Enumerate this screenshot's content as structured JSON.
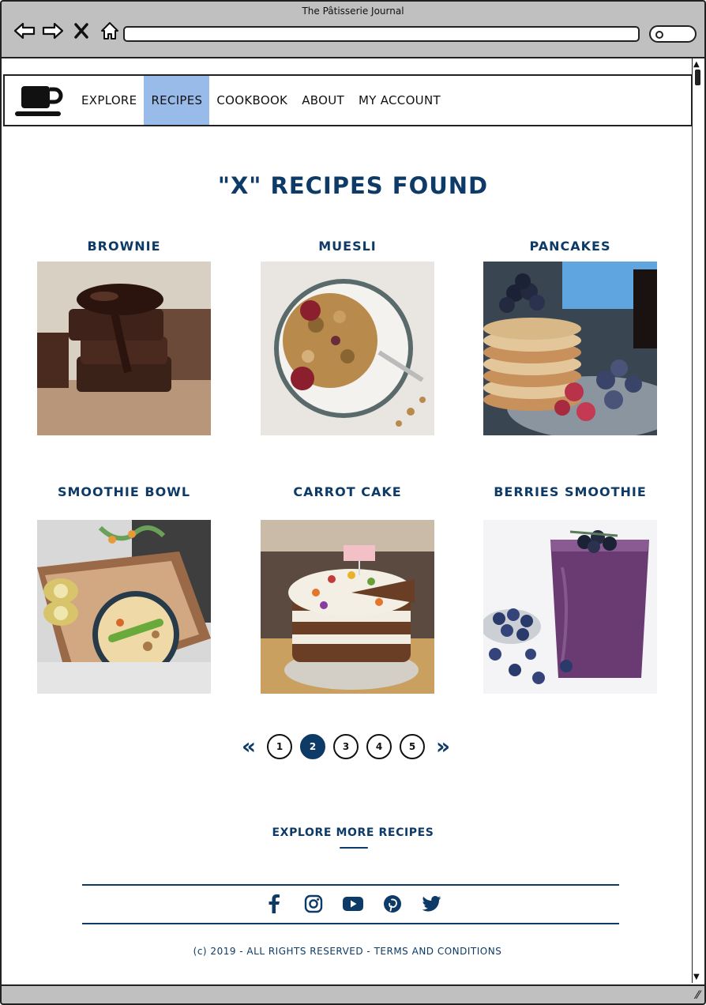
{
  "window": {
    "title": "The Pâtisserie Journal"
  },
  "nav": {
    "links": [
      "EXPLORE",
      "RECIPES",
      "COOKBOOK",
      "ABOUT",
      "MY ACCOUNT"
    ],
    "active": "RECIPES"
  },
  "main": {
    "heading": "\"X\" RECIPES FOUND",
    "recipes": [
      {
        "title": "BROWNIE"
      },
      {
        "title": "MUESLI"
      },
      {
        "title": "PANCAKES"
      },
      {
        "title": "SMOOTHIE BOWL"
      },
      {
        "title": "CARROT CAKE"
      },
      {
        "title": "BERRIES SMOOTHIE"
      }
    ]
  },
  "pagination": {
    "pages": [
      "1",
      "2",
      "3",
      "4",
      "5"
    ],
    "current": "2"
  },
  "footer": {
    "explore_link": "EXPLORE MORE RECIPES",
    "social": [
      "facebook-icon",
      "instagram-icon",
      "youtube-icon",
      "pinterest-icon",
      "twitter-icon"
    ],
    "copyright": "(c) 2019 - ALL RIGHTS RESERVED - TERMS AND CONDITIONS"
  },
  "colors": {
    "primary": "#0d3a66",
    "active_nav": "#99bbea",
    "chrome": "#c0c0c0"
  }
}
